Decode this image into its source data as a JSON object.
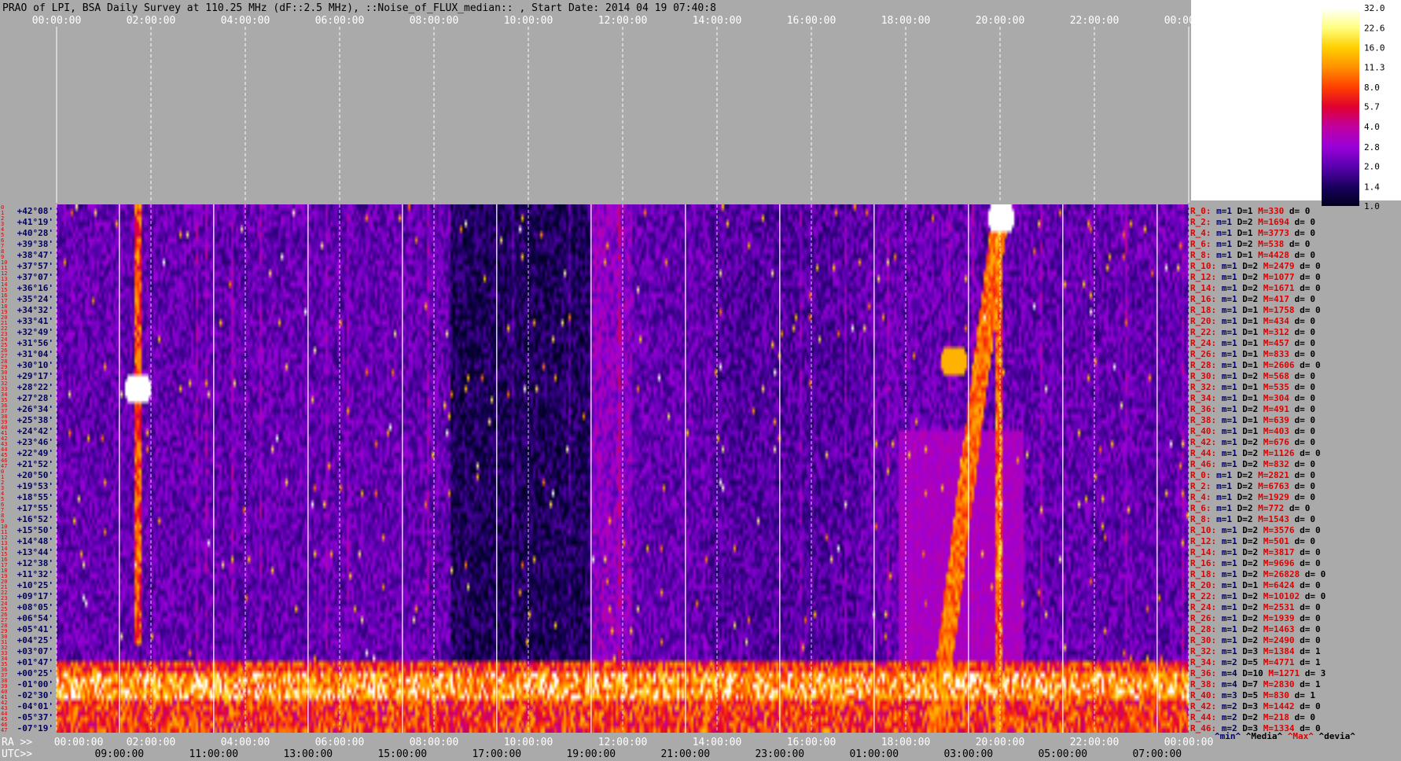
{
  "chart_data": {
    "type": "heatmap",
    "title": "PRAO of LPI, BSA Daily Survey at 110.25 MHz (dF::2.5 MHz), ::Noise_of_FLUX_median:: , Start Date: 2014 04 19 07:40:8",
    "x_axis": {
      "ra_prefix": "RA >>",
      "utc_prefix": "UTC>>",
      "top_ticks": [
        "00:00:00",
        "02:00:00",
        "04:00:00",
        "06:00:00",
        "08:00:00",
        "10:00:00",
        "12:00:00",
        "14:00:00",
        "16:00:00",
        "18:00:00",
        "20:00:00",
        "22:00:00",
        "00:00:00"
      ],
      "ra_ticks": [
        "00:00:00",
        "02:00:00",
        "04:00:00",
        "06:00:00",
        "08:00:00",
        "10:00:00",
        "12:00:00",
        "14:00:00",
        "16:00:00",
        "18:00:00",
        "20:00:00",
        "22:00:00",
        "00:00:00"
      ],
      "utc_ticks": [
        "09:00:00",
        "11:00:00",
        "13:00:00",
        "15:00:00",
        "17:00:00",
        "19:00:00",
        "21:00:00",
        "23:00:00",
        "01:00:00",
        "03:00:00",
        "05:00:00",
        "07:00:00"
      ],
      "range_hours": [
        0,
        24
      ]
    },
    "row_numbers": [
      "0",
      "1",
      "2",
      "3",
      "4",
      "5",
      "6",
      "7",
      "8",
      "9",
      "10",
      "11",
      "12",
      "13",
      "14",
      "15",
      "16",
      "17",
      "18",
      "19",
      "20",
      "21",
      "22",
      "23",
      "24",
      "25",
      "26",
      "27",
      "28",
      "29",
      "30",
      "31",
      "32",
      "33",
      "34",
      "35",
      "36",
      "37",
      "38",
      "39",
      "40",
      "41",
      "42",
      "43",
      "44",
      "45",
      "46",
      "47",
      "0",
      "1",
      "2",
      "3",
      "4",
      "5",
      "6",
      "7",
      "8",
      "9",
      "10",
      "11",
      "12",
      "13",
      "14",
      "15",
      "16",
      "17",
      "18",
      "19",
      "20",
      "21",
      "22",
      "23",
      "24",
      "25",
      "26",
      "27",
      "28",
      "29",
      "30",
      "31",
      "32",
      "33",
      "34",
      "35",
      "36",
      "37",
      "38",
      "39",
      "40",
      "41",
      "42",
      "43",
      "44",
      "45",
      "46",
      "47"
    ],
    "declinations": [
      "+42°08'",
      "+41°19'",
      "+40°28'",
      "+39°38'",
      "+38°47'",
      "+37°57'",
      "+37°07'",
      "+36°16'",
      "+35°24'",
      "+34°32'",
      "+33°41'",
      "+32°49'",
      "+31°56'",
      "+31°04'",
      "+30°10'",
      "+29°17'",
      "+28°22'",
      "+27°28'",
      "+26°34'",
      "+25°38'",
      "+24°42'",
      "+23°46'",
      "+22°49'",
      "+21°52'",
      "+20°50'",
      "+19°53'",
      "+18°55'",
      "+17°55'",
      "+16°52'",
      "+15°50'",
      "+14°48'",
      "+13°44'",
      "+12°38'",
      "+11°32'",
      "+10°25'",
      "+09°17'",
      "+08°05'",
      "+06°54'",
      "+05°41'",
      "+04°25'",
      "+03°07'",
      "+01°47'",
      "+00°25'",
      "-01°00'",
      "-02°30'",
      "-04°01'",
      "-05°37'",
      "-07°19'"
    ],
    "colorbar": {
      "ticks": [
        "32.0",
        "22.6",
        "16.0",
        "11.3",
        "8.0",
        "5.7",
        "4.0",
        "2.8",
        "2.0",
        "1.4",
        "1.0"
      ],
      "range": [
        1.0,
        32.0
      ],
      "scale": "log",
      "colors": [
        "#000020",
        "#1a0060",
        "#5a00b0",
        "#9a00d8",
        "#c000a0",
        "#e00030",
        "#ff4000",
        "#ff9000",
        "#ffd000",
        "#ffff80",
        "#ffffff"
      ]
    },
    "stats": [
      {
        "r": "R_0:",
        "m": "m=1",
        "d": "D=1",
        "M": "M=330",
        "dev": "d= 0"
      },
      {
        "r": "R_2:",
        "m": "m=1",
        "d": "D=2",
        "M": "M=1694",
        "dev": "d= 0"
      },
      {
        "r": "R_4:",
        "m": "m=1",
        "d": "D=1",
        "M": "M=3773",
        "dev": "d= 0"
      },
      {
        "r": "R_6:",
        "m": "m=1",
        "d": "D=2",
        "M": "M=538",
        "dev": "d= 0"
      },
      {
        "r": "R_8:",
        "m": "m=1",
        "d": "D=1",
        "M": "M=4428",
        "dev": "d= 0"
      },
      {
        "r": "R_10:",
        "m": "m=1",
        "d": "D=2",
        "M": "M=2479",
        "dev": "d= 0"
      },
      {
        "r": "R_12:",
        "m": "m=1",
        "d": "D=2",
        "M": "M=1077",
        "dev": "d= 0"
      },
      {
        "r": "R_14:",
        "m": "m=1",
        "d": "D=2",
        "M": "M=1671",
        "dev": "d= 0"
      },
      {
        "r": "R_16:",
        "m": "m=1",
        "d": "D=2",
        "M": "M=417",
        "dev": "d= 0"
      },
      {
        "r": "R_18:",
        "m": "m=1",
        "d": "D=1",
        "M": "M=1758",
        "dev": "d= 0"
      },
      {
        "r": "R_20:",
        "m": "m=1",
        "d": "D=1",
        "M": "M=434",
        "dev": "d= 0"
      },
      {
        "r": "R_22:",
        "m": "m=1",
        "d": "D=1",
        "M": "M=312",
        "dev": "d= 0"
      },
      {
        "r": "R_24:",
        "m": "m=1",
        "d": "D=1",
        "M": "M=457",
        "dev": "d= 0"
      },
      {
        "r": "R_26:",
        "m": "m=1",
        "d": "D=1",
        "M": "M=833",
        "dev": "d= 0"
      },
      {
        "r": "R_28:",
        "m": "m=1",
        "d": "D=1",
        "M": "M=2606",
        "dev": "d= 0"
      },
      {
        "r": "R_30:",
        "m": "m=1",
        "d": "D=2",
        "M": "M=568",
        "dev": "d= 0"
      },
      {
        "r": "R_32:",
        "m": "m=1",
        "d": "D=1",
        "M": "M=535",
        "dev": "d= 0"
      },
      {
        "r": "R_34:",
        "m": "m=1",
        "d": "D=1",
        "M": "M=304",
        "dev": "d= 0"
      },
      {
        "r": "R_36:",
        "m": "m=1",
        "d": "D=2",
        "M": "M=491",
        "dev": "d= 0"
      },
      {
        "r": "R_38:",
        "m": "m=1",
        "d": "D=1",
        "M": "M=639",
        "dev": "d= 0"
      },
      {
        "r": "R_40:",
        "m": "m=1",
        "d": "D=1",
        "M": "M=403",
        "dev": "d= 0"
      },
      {
        "r": "R_42:",
        "m": "m=1",
        "d": "D=2",
        "M": "M=676",
        "dev": "d= 0"
      },
      {
        "r": "R_44:",
        "m": "m=1",
        "d": "D=2",
        "M": "M=1126",
        "dev": "d= 0"
      },
      {
        "r": "R_46:",
        "m": "m=1",
        "d": "D=2",
        "M": "M=832",
        "dev": "d= 0"
      },
      {
        "r": "R_0:",
        "m": "m=1",
        "d": "D=2",
        "M": "M=2821",
        "dev": "d= 0"
      },
      {
        "r": "R_2:",
        "m": "m=1",
        "d": "D=2",
        "M": "M=6763",
        "dev": "d= 0"
      },
      {
        "r": "R_4:",
        "m": "m=1",
        "d": "D=2",
        "M": "M=1929",
        "dev": "d= 0"
      },
      {
        "r": "R_6:",
        "m": "m=1",
        "d": "D=2",
        "M": "M=772",
        "dev": "d= 0"
      },
      {
        "r": "R_8:",
        "m": "m=1",
        "d": "D=2",
        "M": "M=1543",
        "dev": "d= 0"
      },
      {
        "r": "R_10:",
        "m": "m=1",
        "d": "D=2",
        "M": "M=3576",
        "dev": "d= 0"
      },
      {
        "r": "R_12:",
        "m": "m=1",
        "d": "D=2",
        "M": "M=501",
        "dev": "d= 0"
      },
      {
        "r": "R_14:",
        "m": "m=1",
        "d": "D=2",
        "M": "M=3817",
        "dev": "d= 0"
      },
      {
        "r": "R_16:",
        "m": "m=1",
        "d": "D=2",
        "M": "M=9696",
        "dev": "d= 0"
      },
      {
        "r": "R_18:",
        "m": "m=1",
        "d": "D=2",
        "M": "M=26828",
        "dev": "d= 0"
      },
      {
        "r": "R_20:",
        "m": "m=1",
        "d": "D=1",
        "M": "M=6424",
        "dev": "d= 0"
      },
      {
        "r": "R_22:",
        "m": "m=1",
        "d": "D=2",
        "M": "M=10102",
        "dev": "d= 0"
      },
      {
        "r": "R_24:",
        "m": "m=1",
        "d": "D=2",
        "M": "M=2531",
        "dev": "d= 0"
      },
      {
        "r": "R_26:",
        "m": "m=1",
        "d": "D=2",
        "M": "M=1939",
        "dev": "d= 0"
      },
      {
        "r": "R_28:",
        "m": "m=1",
        "d": "D=2",
        "M": "M=1463",
        "dev": "d= 0"
      },
      {
        "r": "R_30:",
        "m": "m=1",
        "d": "D=2",
        "M": "M=2490",
        "dev": "d= 0"
      },
      {
        "r": "R_32:",
        "m": "m=1",
        "d": "D=3",
        "M": "M=1384",
        "dev": "d= 1"
      },
      {
        "r": "R_34:",
        "m": "m=2",
        "d": "D=5",
        "M": "M=4771",
        "dev": "d= 1"
      },
      {
        "r": "R_36:",
        "m": "m=4",
        "d": "D=10",
        "M": "M=1271",
        "dev": "d= 3"
      },
      {
        "r": "R_38:",
        "m": "m=4",
        "d": "D=7",
        "M": "M=2830",
        "dev": "d= 1"
      },
      {
        "r": "R_40:",
        "m": "m=3",
        "d": "D=5",
        "M": "M=830",
        "dev": "d= 1"
      },
      {
        "r": "R_42:",
        "m": "m=2",
        "d": "D=3",
        "M": "M=1442",
        "dev": "d= 0"
      },
      {
        "r": "R_44:",
        "m": "m=2",
        "d": "D=2",
        "M": "M=218",
        "dev": "d= 0"
      },
      {
        "r": "R_46:",
        "m": "m=2",
        "d": "D=3",
        "M": "M=1334",
        "dev": "d= 0"
      }
    ],
    "stats_footer": {
      "min": "^min^",
      "median": "^Media^",
      "max": "^Max^",
      "dev": "^devia^"
    },
    "features": [
      {
        "ra_h": 1.7,
        "row": 33,
        "value": 32
      },
      {
        "ra_h": 20.0,
        "row": 2,
        "value": 32
      },
      {
        "ra_h": 19.0,
        "row": 28,
        "value": 22
      }
    ]
  }
}
